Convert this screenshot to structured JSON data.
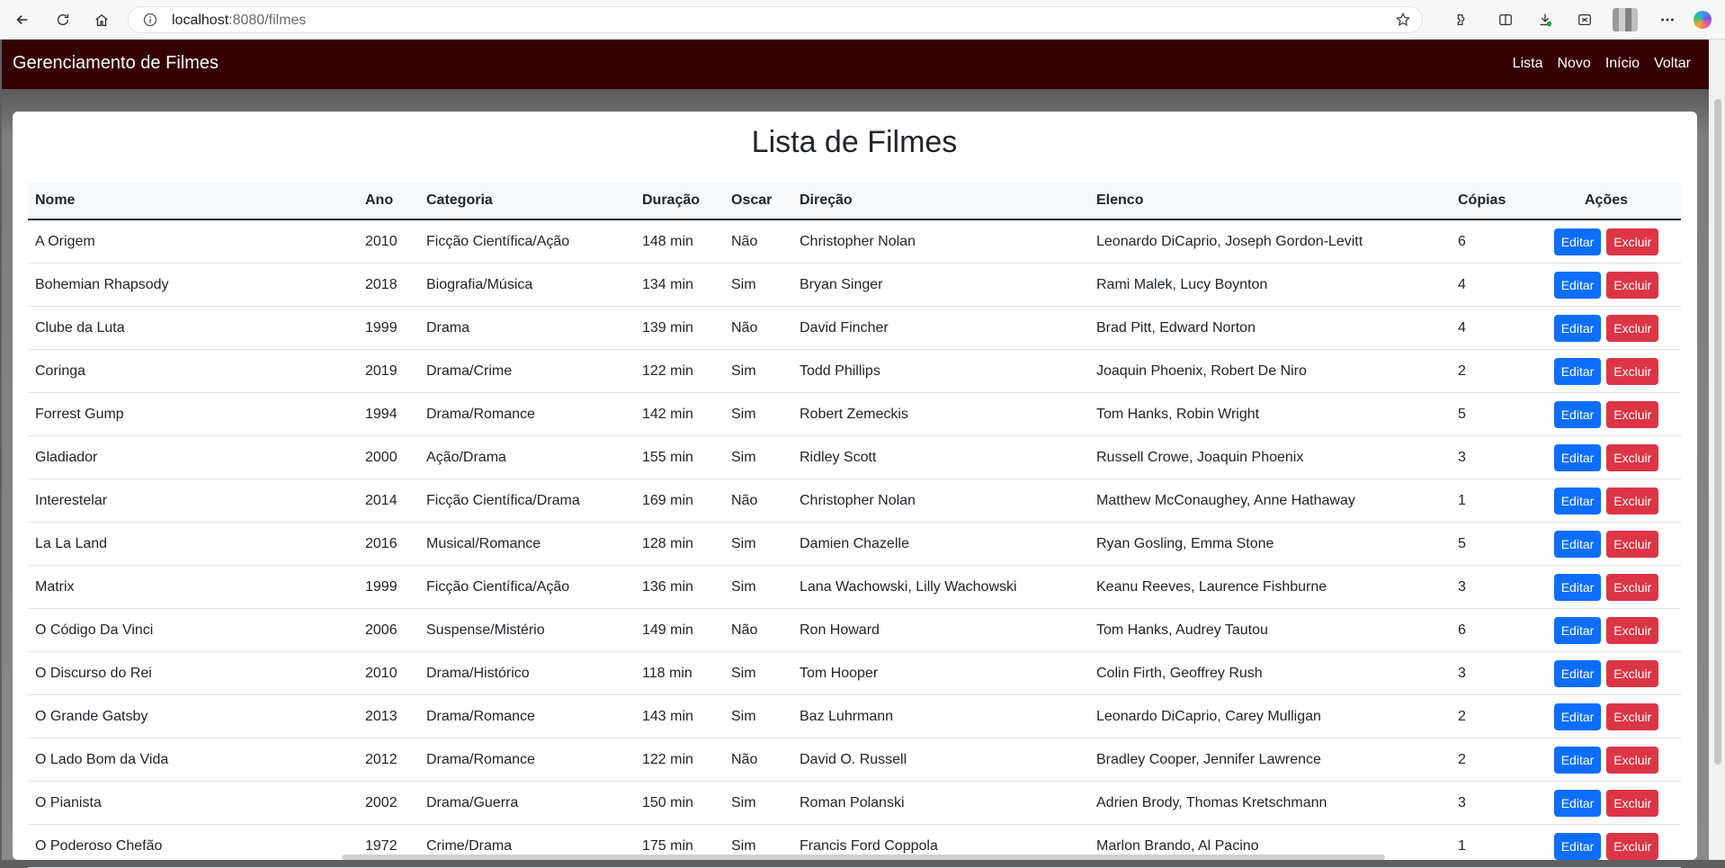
{
  "browser": {
    "url_host": "localhost",
    "url_path": ":8080/filmes"
  },
  "navbar": {
    "brand": "Gerenciamento de Filmes",
    "links": [
      "Lista",
      "Novo",
      "Início",
      "Voltar"
    ]
  },
  "page": {
    "title": "Lista de Filmes"
  },
  "table": {
    "headers": [
      "Nome",
      "Ano",
      "Categoria",
      "Duração",
      "Oscar",
      "Direção",
      "Elenco",
      "Cópias",
      "Ações"
    ],
    "edit_label": "Editar",
    "delete_label": "Excluir",
    "rows": [
      [
        "A Origem",
        "2010",
        "Ficção Científica/Ação",
        "148 min",
        "Não",
        "Christopher Nolan",
        "Leonardo DiCaprio, Joseph Gordon-Levitt",
        "6"
      ],
      [
        "Bohemian Rhapsody",
        "2018",
        "Biografia/Música",
        "134 min",
        "Sim",
        "Bryan Singer",
        "Rami Malek, Lucy Boynton",
        "4"
      ],
      [
        "Clube da Luta",
        "1999",
        "Drama",
        "139 min",
        "Não",
        "David Fincher",
        "Brad Pitt, Edward Norton",
        "4"
      ],
      [
        "Coringa",
        "2019",
        "Drama/Crime",
        "122 min",
        "Sim",
        "Todd Phillips",
        "Joaquin Phoenix, Robert De Niro",
        "2"
      ],
      [
        "Forrest Gump",
        "1994",
        "Drama/Romance",
        "142 min",
        "Sim",
        "Robert Zemeckis",
        "Tom Hanks, Robin Wright",
        "5"
      ],
      [
        "Gladiador",
        "2000",
        "Ação/Drama",
        "155 min",
        "Sim",
        "Ridley Scott",
        "Russell Crowe, Joaquin Phoenix",
        "3"
      ],
      [
        "Interestelar",
        "2014",
        "Ficção Científica/Drama",
        "169 min",
        "Não",
        "Christopher Nolan",
        "Matthew McConaughey, Anne Hathaway",
        "1"
      ],
      [
        "La La Land",
        "2016",
        "Musical/Romance",
        "128 min",
        "Sim",
        "Damien Chazelle",
        "Ryan Gosling, Emma Stone",
        "5"
      ],
      [
        "Matrix",
        "1999",
        "Ficção Científica/Ação",
        "136 min",
        "Sim",
        "Lana Wachowski, Lilly Wachowski",
        "Keanu Reeves, Laurence Fishburne",
        "3"
      ],
      [
        "O Código Da Vinci",
        "2006",
        "Suspense/Mistério",
        "149 min",
        "Não",
        "Ron Howard",
        "Tom Hanks, Audrey Tautou",
        "6"
      ],
      [
        "O Discurso do Rei",
        "2010",
        "Drama/Histórico",
        "118 min",
        "Sim",
        "Tom Hooper",
        "Colin Firth, Geoffrey Rush",
        "3"
      ],
      [
        "O Grande Gatsby",
        "2013",
        "Drama/Romance",
        "143 min",
        "Sim",
        "Baz Luhrmann",
        "Leonardo DiCaprio, Carey Mulligan",
        "2"
      ],
      [
        "O Lado Bom da Vida",
        "2012",
        "Drama/Romance",
        "122 min",
        "Não",
        "David O. Russell",
        "Bradley Cooper, Jennifer Lawrence",
        "2"
      ],
      [
        "O Pianista",
        "2002",
        "Drama/Guerra",
        "150 min",
        "Sim",
        "Roman Polanski",
        "Adrien Brody, Thomas Kretschmann",
        "3"
      ],
      [
        "O Poderoso Chefão",
        "1972",
        "Crime/Drama",
        "175 min",
        "Sim",
        "Francis Ford Coppola",
        "Marlon Brando, Al Pacino",
        "1"
      ]
    ]
  },
  "colors": {
    "navbar_bg": "#360000",
    "edit_button": "#0d6efd",
    "delete_button": "#dc3545"
  }
}
